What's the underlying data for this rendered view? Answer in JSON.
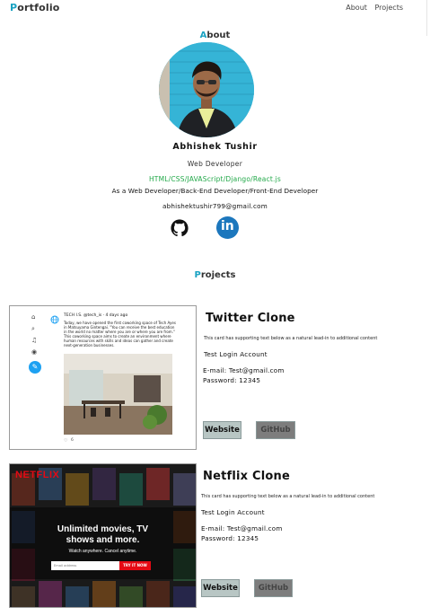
{
  "nav": {
    "brand_first": "P",
    "brand_rest": "ortfolio",
    "links": [
      "About",
      "Projects"
    ]
  },
  "about": {
    "title_first": "A",
    "title_rest": "bout",
    "name": "Abhishek Tushir",
    "role": "Web Developer",
    "skills": "HTML/CSS/JAVAScript/Django/React.js",
    "description": "As a Web Developer/Back-End Developer/Front-End Developer",
    "email": "abhishektushir799@gmail.com",
    "social_icons": [
      "github-icon",
      "linkedin-icon"
    ],
    "linkedin_glyph": "in"
  },
  "projects": {
    "title_first": "P",
    "title_rest": "rojects",
    "items": [
      {
        "title": "Twitter Clone",
        "blurb": "This card has supporting text below as a natural lead-in to additional content",
        "account_label": "Test Login Account",
        "email_line": "E-mail: Test@gmail.com",
        "password_line": "Password: 12345",
        "website_label": "Website",
        "github_label": "GitHub",
        "screenshot": {
          "handle": "TECH I.S. @tech_is · 4 days ago",
          "text": "Today, we have opened the first coworking space of Tech Ayes in Matsuyama Gintengai. \"You can receive the best education in the world no matter where you are or where you are from.\" This coworking space aims to create an environment where human resources with skills and ideas can gather and create next-generation businesses.",
          "likes": "6"
        }
      },
      {
        "title": "Netflix Clone",
        "blurb": "This card has supporting text below as a natural lead-in to additional content",
        "account_label": "Test Login Account",
        "email_line": "E-mail: Test@gmail.com",
        "password_line": "Password: 12345",
        "website_label": "Website",
        "github_label": "GitHub",
        "screenshot": {
          "logo": "NETFLIX",
          "headline_1": "Unlimited movies, TV",
          "headline_2": "shows and more.",
          "sub": "Watch anywhere. Cancel anytime.",
          "input_placeholder": "Email address",
          "cta": "TRY IT NOW"
        }
      }
    ]
  },
  "colors": {
    "accent": "#19a2c2",
    "skills_green": "#23a94a",
    "linkedin_blue": "#1c77bd",
    "netflix_red": "#e50914",
    "twitter_blue": "#1da1f2"
  }
}
